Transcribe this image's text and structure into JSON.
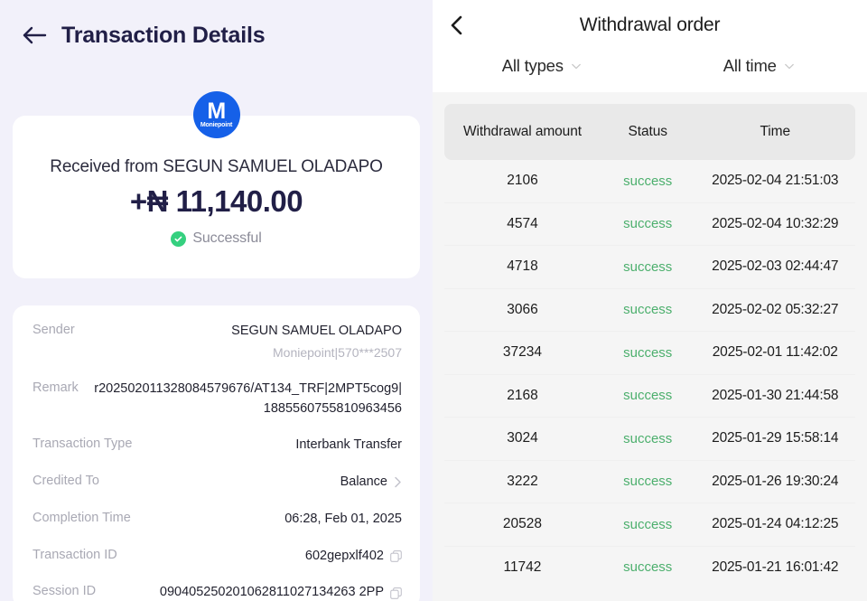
{
  "transaction_details": {
    "header": {
      "title": "Transaction Details",
      "back_icon": "arrow-left-icon"
    },
    "summary": {
      "logo_letter": "M",
      "logo_word": "Moniepoint",
      "received_label": "Received from SEGUN SAMUEL OLADAPO",
      "amount": "+₦ 11,140.00",
      "status": "Successful",
      "status_color": "#35d07f"
    },
    "rows": [
      {
        "label": "Sender",
        "value": "SEGUN SAMUEL OLADAPO",
        "sub": "Moniepoint|570***2507"
      },
      {
        "label": "Remark",
        "value": "r202502011328084579676/AT134_TRF|2MPT5cog9|1885560755810963456"
      },
      {
        "label": "Transaction Type",
        "value": "Interbank Transfer"
      },
      {
        "label": "Credited To",
        "value": "Balance",
        "chevron": "chevron-right-icon"
      },
      {
        "label": "Completion Time",
        "value": "06:28, Feb 01, 2025"
      },
      {
        "label": "Transaction ID",
        "value": "602gepxlf402",
        "copy": "copy-icon"
      },
      {
        "label": "Session ID",
        "value": "090405250201062811027134263 2PP",
        "copy": "copy-icon"
      }
    ]
  },
  "withdrawal_order": {
    "header": {
      "title": "Withdrawal order",
      "back_icon": "chevron-left-icon"
    },
    "filters": [
      {
        "label": "All types",
        "caret": "caret-down-icon"
      },
      {
        "label": "All time",
        "caret": "caret-down-icon"
      }
    ],
    "table": {
      "columns": [
        "Withdrawal amount",
        "Status",
        "Time"
      ],
      "rows": [
        {
          "amount": "2106",
          "status": "success",
          "time": "2025-02-04 21:51:03"
        },
        {
          "amount": "4574",
          "status": "success",
          "time": "2025-02-04 10:32:29"
        },
        {
          "amount": "4718",
          "status": "success",
          "time": "2025-02-03 02:44:47"
        },
        {
          "amount": "3066",
          "status": "success",
          "time": "2025-02-02 05:32:27"
        },
        {
          "amount": "37234",
          "status": "success",
          "time": "2025-02-01 11:42:02"
        },
        {
          "amount": "2168",
          "status": "success",
          "time": "2025-01-30 21:44:58"
        },
        {
          "amount": "3024",
          "status": "success",
          "time": "2025-01-29 15:58:14"
        },
        {
          "amount": "3222",
          "status": "success",
          "time": "2025-01-26 19:30:24"
        },
        {
          "amount": "20528",
          "status": "success",
          "time": "2025-01-24 04:12:25"
        },
        {
          "amount": "11742",
          "status": "success",
          "time": "2025-01-21 16:01:42"
        }
      ],
      "status_color": "#4caf6d"
    }
  }
}
